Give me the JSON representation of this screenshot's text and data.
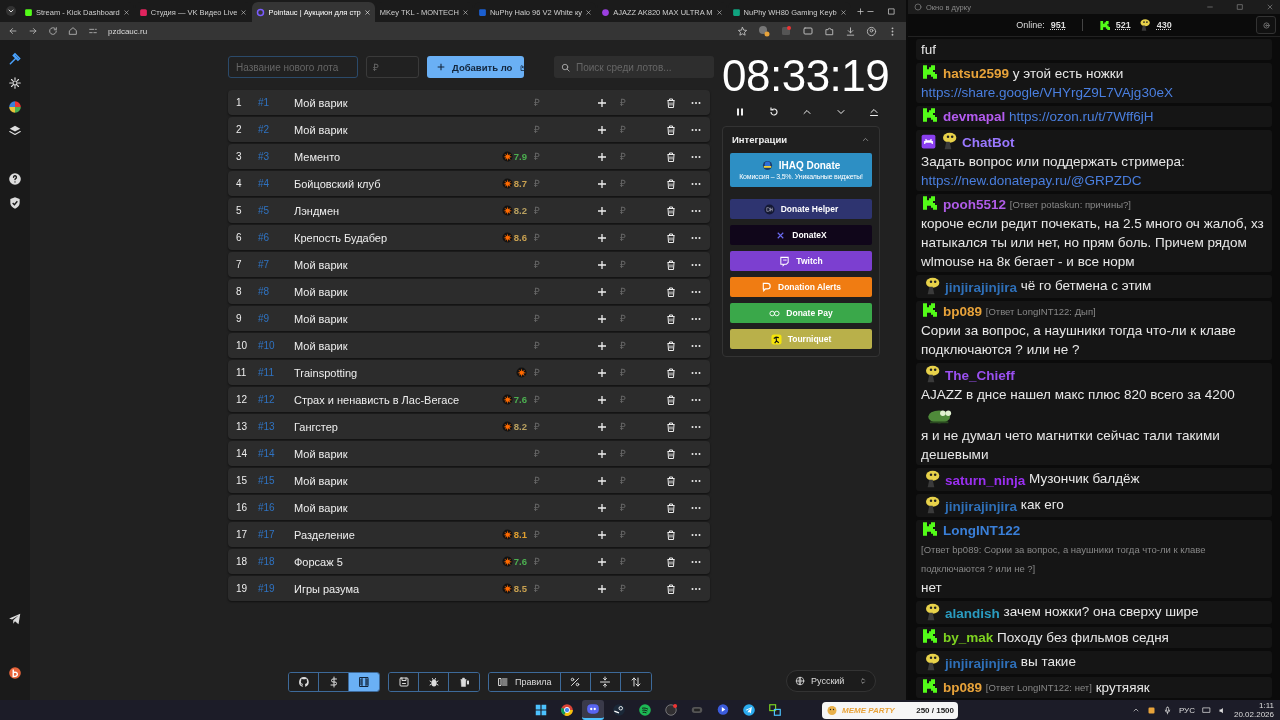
{
  "browser": {
    "tabs": [
      {
        "title": "Stream - Kick Dashboard",
        "selected": false
      },
      {
        "title": "Студия — VK Видео Live",
        "selected": false
      },
      {
        "title": "Pointauc | Аукцион для стр",
        "selected": true
      },
      {
        "title": "MKey TKL - MONTECH",
        "selected": false
      },
      {
        "title": "NuPhy Halo 96 V2 White ку",
        "selected": false
      },
      {
        "title": "AJAZZ AK820 MAX ULTRA M",
        "selected": false
      },
      {
        "title": "NuPhy WH80 Gaming Keyb",
        "selected": false
      }
    ],
    "url": "pzdcauc.ru"
  },
  "lot_form": {
    "name_placeholder": "Название нового лота",
    "price_placeholder": "₽",
    "add_button": "Добавить ло",
    "search_placeholder": "Поиск среди лотов..."
  },
  "lots": [
    {
      "index": "1",
      "id": "#1",
      "name": "Мой варик",
      "rated": false,
      "amount_placeholder": "₽",
      "add_placeholder": "₽"
    },
    {
      "index": "2",
      "id": "#2",
      "name": "Мой варик",
      "rated": false,
      "amount_placeholder": "₽",
      "add_placeholder": "₽"
    },
    {
      "index": "3",
      "id": "#3",
      "name": "Мементо",
      "rated": true,
      "rating": "7.9",
      "color": "#4caf50",
      "amount_placeholder": "₽",
      "add_placeholder": "₽"
    },
    {
      "index": "4",
      "id": "#4",
      "name": "Бойцовский клуб",
      "rated": true,
      "rating": "8.7",
      "color": "#c8a050",
      "amount_placeholder": "₽",
      "add_placeholder": "₽"
    },
    {
      "index": "5",
      "id": "#5",
      "name": "Лэндмен",
      "rated": true,
      "rating": "8.2",
      "color": "#b8a060",
      "amount_placeholder": "₽",
      "add_placeholder": "₽"
    },
    {
      "index": "6",
      "id": "#6",
      "name": "Крепость Будабер",
      "rated": true,
      "rating": "8.6",
      "color": "#c8a050",
      "amount_placeholder": "₽",
      "add_placeholder": "₽"
    },
    {
      "index": "7",
      "id": "#7",
      "name": "Мой варик",
      "rated": false,
      "amount_placeholder": "₽",
      "add_placeholder": "₽"
    },
    {
      "index": "8",
      "id": "#8",
      "name": "Мой варик",
      "rated": false,
      "amount_placeholder": "₽",
      "add_placeholder": "₽"
    },
    {
      "index": "9",
      "id": "#9",
      "name": "Мой варик",
      "rated": false,
      "amount_placeholder": "₽",
      "add_placeholder": "₽"
    },
    {
      "index": "10",
      "id": "#10",
      "name": "Мой варик",
      "rated": false,
      "amount_placeholder": "₽",
      "add_placeholder": "₽"
    },
    {
      "index": "11",
      "id": "#11",
      "name": "Trainspotting",
      "rated": true,
      "amount_placeholder": "₽",
      "add_placeholder": "₽"
    },
    {
      "index": "12",
      "id": "#12",
      "name": "Страх и ненависть в Лас-Вегасе",
      "rated": true,
      "rating": "7.6",
      "color": "#4caf50",
      "amount_placeholder": "₽",
      "add_placeholder": "₽"
    },
    {
      "index": "13",
      "id": "#13",
      "name": "Гангстер",
      "rated": true,
      "rating": "8.2",
      "color": "#b8a060",
      "amount_placeholder": "₽",
      "add_placeholder": "₽"
    },
    {
      "index": "14",
      "id": "#14",
      "name": "Мой варик",
      "rated": false,
      "amount_placeholder": "₽",
      "add_placeholder": "₽"
    },
    {
      "index": "15",
      "id": "#15",
      "name": "Мой варик",
      "rated": false,
      "amount_placeholder": "₽",
      "add_placeholder": "₽"
    },
    {
      "index": "16",
      "id": "#16",
      "name": "Мой варик",
      "rated": false,
      "amount_placeholder": "₽",
      "add_placeholder": "₽"
    },
    {
      "index": "17",
      "id": "#17",
      "name": "Разделение",
      "rated": true,
      "rating": "8.1",
      "color": "#e0a030",
      "amount_placeholder": "₽",
      "add_placeholder": "₽"
    },
    {
      "index": "18",
      "id": "#18",
      "name": "Форсаж 5",
      "rated": true,
      "rating": "7.6",
      "color": "#4caf50",
      "amount_placeholder": "₽",
      "add_placeholder": "₽"
    },
    {
      "index": "19",
      "id": "#19",
      "name": "Игры разума",
      "rated": true,
      "rating": "8.5",
      "color": "#c8a050",
      "amount_placeholder": "₽",
      "add_placeholder": "₽"
    }
  ],
  "timer": {
    "time": "08:33:19"
  },
  "integrations": {
    "title": "Интеграции",
    "expanded": true,
    "buttons": [
      {
        "label": "IHAQ Donate",
        "subtitle": "Комиссия – 3,5%. Уникальные виджеты!",
        "color": "#2d8fc4"
      },
      {
        "label": "Donate Helper",
        "color": "#2e3470"
      },
      {
        "label": "DonateX",
        "color": "#10061a"
      },
      {
        "label": "Twitch",
        "color": "#7c3fd0"
      },
      {
        "label": "Donation Alerts",
        "color": "#f07c12"
      },
      {
        "label": "Donate Pay",
        "color": "#3aa84a"
      },
      {
        "label": "Tourniquet",
        "color": "#b9b04a"
      }
    ]
  },
  "toolbar": {
    "groups": [
      [
        {
          "selected": false
        },
        {
          "selected": false
        },
        {
          "selected": true
        }
      ],
      [
        {
          "selected": false
        },
        {
          "selected": false
        },
        {
          "selected": false
        }
      ],
      [
        {
          "label": "Правила",
          "selected": false
        },
        {
          "selected": false
        },
        {
          "selected": false
        },
        {
          "selected": false
        }
      ]
    ]
  },
  "language": "Русский",
  "chat": {
    "title": "Окно в дурку",
    "online_label": "Online:",
    "online": "951",
    "kick_count": "521",
    "mascot_count": "430",
    "messages": [
      {
        "segments": [
          {
            "kind": "text",
            "text": "fuf"
          }
        ]
      },
      {
        "kind": "kick",
        "user": "hatsu2599",
        "color": "#e8a33a",
        "segments": [
          {
            "kind": "text",
            "text": "у этой есть ножки"
          },
          {
            "kind": "link",
            "text": "https://share.google/VHYrgZ9L7VAjg30eX"
          }
        ]
      },
      {
        "kind": "kick",
        "user": "devmapal",
        "color": "#b45cf0",
        "segments": [
          {
            "kind": "link",
            "text": "https://ozon.ru/t/7Wff6jH"
          }
        ]
      },
      {
        "kind": "mascot",
        "bot": true,
        "user": "ChatBot",
        "color": "#9a78ff",
        "segments": [
          {
            "kind": "text",
            "text": "Задать вопрос или поддержать стримера:"
          },
          {
            "kind": "link",
            "text": "https://new.donatepay.ru/@GRPZDC"
          }
        ]
      },
      {
        "kind": "kick",
        "user": "pooh5512",
        "color": "#b05ce8",
        "reply": "[Ответ potaskun: причины?]",
        "segments": [
          {
            "kind": "text",
            "text": "короче если редит почекать, на 2.5 много оч жалоб, хз натыкался ты или нет, но прям боль. Причем рядом wlmouse на 8к бегает - и все норм"
          }
        ]
      },
      {
        "kind": "mascot",
        "user": "jinjirajinjira",
        "color": "#2e6fb8",
        "segments": [
          {
            "kind": "text",
            "text": "чё го бетмена с этим"
          }
        ]
      },
      {
        "kind": "kick",
        "user": "bp089",
        "color": "#e8a33a",
        "reply": "[Ответ LongINT122: Дып]",
        "segments": [
          {
            "kind": "text",
            "text": "Сории за вопрос, а наушники тогда что-ли к клаве подключаются ? или не ?"
          }
        ]
      },
      {
        "kind": "mascot",
        "user": "The_Chieff",
        "color": "#9a50f0",
        "segments": [
          {
            "kind": "text",
            "text": "AJAZZ в днсе нашел макс плюс 820 всего за 4200"
          },
          {
            "kind": "emote"
          },
          {
            "kind": "text",
            "text": "я и не думал чето магнитки сейчас тали такими дешевыми"
          }
        ]
      },
      {
        "kind": "mascot",
        "user": "saturn_ninja",
        "color": "#9a2ff0",
        "segments": [
          {
            "kind": "text",
            "text": "Музончик балдёж"
          }
        ]
      },
      {
        "kind": "mascot",
        "user": "jinjirajinjira",
        "color": "#2e6fb8",
        "segments": [
          {
            "kind": "text",
            "text": "как его"
          }
        ]
      },
      {
        "kind": "kick",
        "user": "LongINT122",
        "color": "#3a7fd8",
        "reply": "[Ответ bp089: Сории за вопрос, а наушники тогда что-ли к клаве подключаются ? или не ?]",
        "segments": [
          {
            "kind": "text",
            "text": "нет"
          }
        ]
      },
      {
        "kind": "mascot",
        "user": "alandish",
        "color": "#2a9bc0",
        "segments": [
          {
            "kind": "text",
            "text": "зачем ножки? она сверху шире"
          }
        ]
      },
      {
        "kind": "kick",
        "user": "by_mak",
        "color": "#7ed321",
        "segments": [
          {
            "kind": "text",
            "text": "Походу без фильмов седня"
          }
        ]
      },
      {
        "kind": "mascot",
        "user": "jinjirajinjira",
        "color": "#2e6fb8",
        "segments": [
          {
            "kind": "text",
            "text": "вы такие"
          }
        ]
      },
      {
        "kind": "kick",
        "user": "bp089",
        "color": "#e8a33a",
        "reply": "[Ответ LongINT122: нет]",
        "segments": [
          {
            "kind": "text",
            "text": "крутяяяк"
          }
        ]
      }
    ]
  },
  "taskbar": {
    "apps": [
      {
        "selected": false
      },
      {
        "selected": false
      },
      {
        "selected": true
      },
      {
        "selected": false
      },
      {
        "selected": false
      },
      {
        "selected": false
      },
      {
        "selected": false
      },
      {
        "selected": false
      },
      {
        "selected": false
      },
      {
        "selected": false
      }
    ],
    "widget_title": "MEME PARTY",
    "widget_counter": "250 / 1500",
    "language": "РУС",
    "time": "1:11",
    "date": "20.02.2026"
  }
}
